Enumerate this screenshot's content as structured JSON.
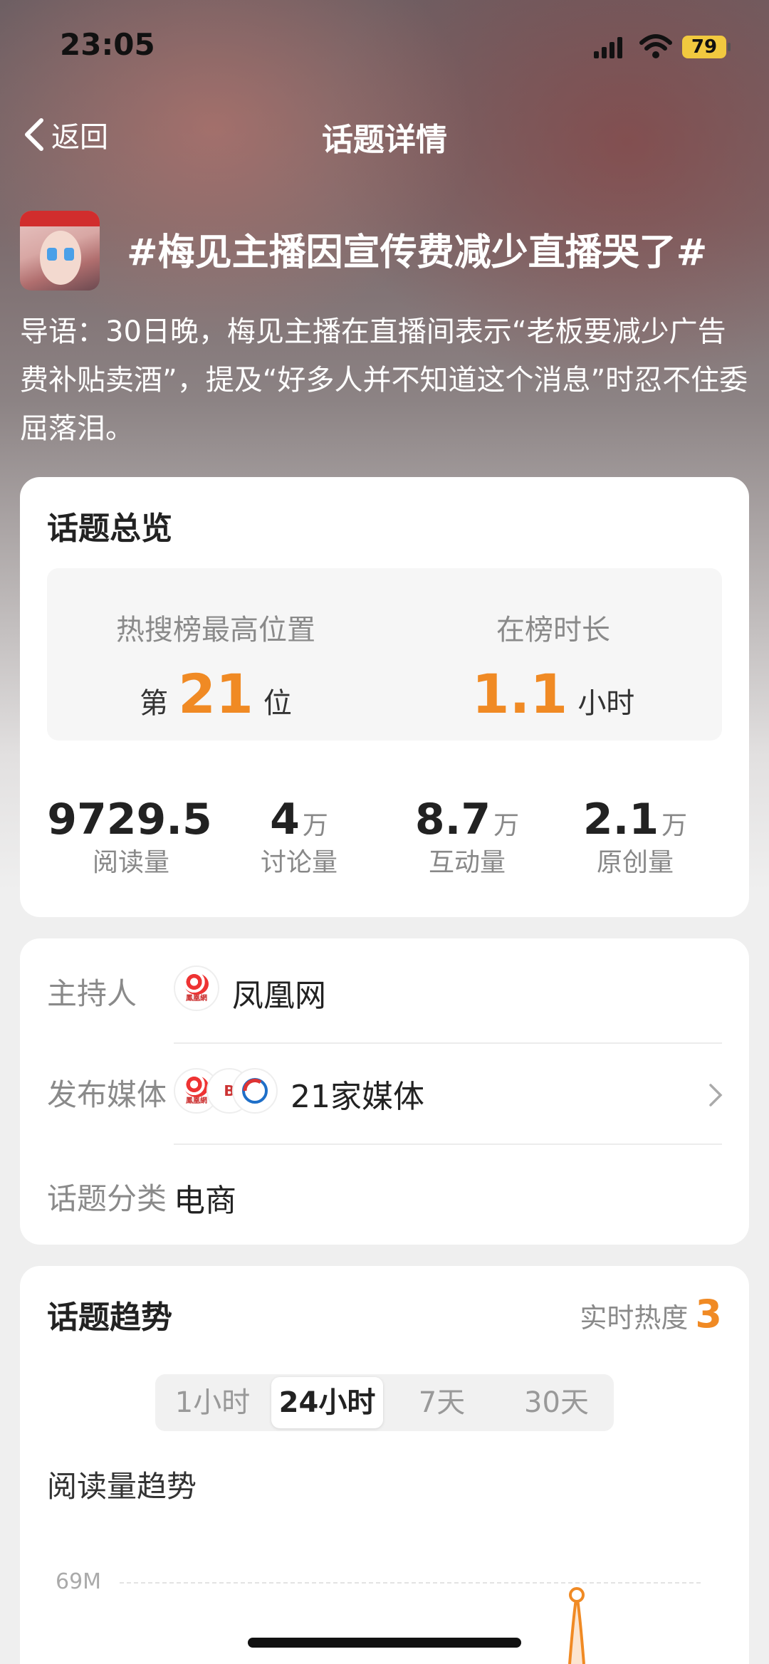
{
  "status_bar": {
    "time": "23:05",
    "battery": "79"
  },
  "nav": {
    "back_label": "返回",
    "title": "话题详情"
  },
  "topic": {
    "title": "#梅见主播因宣传费减少直播哭了#",
    "intro": "导语：30日晚，梅见主播在直播间表示“老板要减少广告费补贴卖酒”，提及“好多人并不知道这个消息”时忍不住委屈落泪。"
  },
  "overview": {
    "title": "话题总览",
    "rank_label": "热搜榜最高位置",
    "rank_prefix": "第",
    "rank_value": "21",
    "rank_suffix": "位",
    "duration_label": "在榜时长",
    "duration_value": "1.1",
    "duration_unit": "小时",
    "stats": [
      {
        "value": "9729.5",
        "unit": "",
        "label": "阅读量"
      },
      {
        "value": "4",
        "unit": "万",
        "label": "讨论量"
      },
      {
        "value": "8.7",
        "unit": "万",
        "label": "互动量"
      },
      {
        "value": "2.1",
        "unit": "万",
        "label": "原创量"
      }
    ]
  },
  "info": {
    "host_label": "主持人",
    "host_value": "凤凰网",
    "media_label": "发布媒体",
    "media_value": "21家媒体",
    "category_label": "话题分类",
    "category_value": "电商"
  },
  "trend": {
    "title": "话题趋势",
    "realtime_label": "实时热度",
    "realtime_value": "3",
    "ranges": [
      "1小时",
      "24小时",
      "7天",
      "30天"
    ],
    "active_range": "24小时",
    "chart_title": "阅读量趋势",
    "y_tick": "69M"
  },
  "colors": {
    "accent": "#f08a24",
    "battery": "#f1c93f"
  }
}
